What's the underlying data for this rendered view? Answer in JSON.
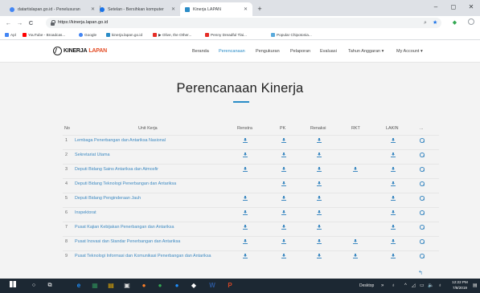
{
  "browser": {
    "tabs": [
      {
        "label": "datartislapan.go.id - Penelusuran",
        "close": "✕",
        "favicon_color": "#4285f4"
      },
      {
        "label": "Setelan - Bersihkan komputer",
        "close": "✕",
        "favicon_color": "#1a73e8"
      },
      {
        "label": "Kinerja LAPAN",
        "close": "✕",
        "favicon_color": "#2a8cc7"
      }
    ],
    "new_tab": "+",
    "window_controls": {
      "minimize": "–",
      "maximize": "◻",
      "close": "✕"
    },
    "nav": {
      "back": "←",
      "forward": "→",
      "reload": "C"
    },
    "url": "https://kinerja.lapan.go.id",
    "bookmarks": [
      {
        "label": "Apl",
        "color": "#4285f4"
      },
      {
        "label": "YouTube - Broadcas...",
        "color": "#ff0000"
      },
      {
        "label": "Google",
        "color": "#4285f4"
      },
      {
        "label": "kinerja.lapan.go.id",
        "color": "#2a8cc7"
      },
      {
        "label": "▶ Olive, the Other...",
        "color": "#e52d27"
      },
      {
        "label": "Penny Dreadful Tlai...",
        "color": "#e52d27"
      },
      {
        "label": "Popular Chipotonia...",
        "color": "#5aaadc"
      }
    ]
  },
  "site": {
    "logo_primary": "KINERJA",
    "logo_accent": "LAPAN",
    "nav": [
      {
        "label": "Beranda",
        "active": false
      },
      {
        "label": "Perencanaan",
        "active": true
      },
      {
        "label": "Pengukuran",
        "active": false
      },
      {
        "label": "Pelaporan",
        "active": false
      },
      {
        "label": "Evaluasi",
        "active": false
      },
      {
        "label": "Tahun Anggaran ▾",
        "active": false
      },
      {
        "label": "My Account ▾",
        "active": false
      }
    ],
    "accent_color": "#2a8cc7"
  },
  "main": {
    "title": "Perencanaan Kinerja",
    "table": {
      "headers": [
        "No",
        "Unit Kerja",
        "Renstra",
        "PK",
        "Renaksi",
        "RKT",
        "LAKIN",
        "..."
      ],
      "rows": [
        {
          "no": "1",
          "unit": "Lembaga Penerbangan dan Antariksa Nasional",
          "renstra": true,
          "pk": true,
          "renaksi": true,
          "rkt": false,
          "lakin": true
        },
        {
          "no": "2",
          "unit": "Sekretariat Utama",
          "renstra": true,
          "pk": true,
          "renaksi": true,
          "rkt": false,
          "lakin": true
        },
        {
          "no": "3",
          "unit": "Deputi Bidang Sains Antariksa dan Atmosfir",
          "renstra": true,
          "pk": true,
          "renaksi": true,
          "rkt": true,
          "lakin": true
        },
        {
          "no": "4",
          "unit": "Deputi Bidang Teknologi Penerbangan dan Antariksa",
          "renstra": false,
          "pk": true,
          "renaksi": true,
          "rkt": false,
          "lakin": true
        },
        {
          "no": "5",
          "unit": "Deputi Bidang Penginderaan Jauh",
          "renstra": true,
          "pk": true,
          "renaksi": true,
          "rkt": false,
          "lakin": true
        },
        {
          "no": "6",
          "unit": "Inspektorat",
          "renstra": true,
          "pk": true,
          "renaksi": true,
          "rkt": false,
          "lakin": true
        },
        {
          "no": "7",
          "unit": "Pusat Kajian Kebijakan Penerbangan dan Antariksa",
          "renstra": true,
          "pk": true,
          "renaksi": true,
          "rkt": false,
          "lakin": true
        },
        {
          "no": "8",
          "unit": "Pusat Inovasi dan Standar Penerbangan dan Antariksa",
          "renstra": true,
          "pk": true,
          "renaksi": true,
          "rkt": true,
          "lakin": true
        },
        {
          "no": "9",
          "unit": "Pusat Teknologi Informasi dan Komunikasi Penerbangan dan Antariksa",
          "renstra": true,
          "pk": true,
          "renaksi": true,
          "rkt": true,
          "lakin": true
        }
      ]
    },
    "undo_glyph": "↰"
  },
  "taskbar": {
    "desktop_label": "Desktop",
    "time": "12:22 PM",
    "date": "7/8/2019",
    "apps": [
      {
        "color": "#1e90ff",
        "glyph": "e"
      },
      {
        "color": "#2e8b57",
        "glyph": "▦"
      },
      {
        "color": "#f4b400",
        "glyph": "▤"
      },
      {
        "color": "#e0e0e0",
        "glyph": "▣"
      },
      {
        "color": "#ff7f27",
        "glyph": "●"
      },
      {
        "color": "#34a853",
        "glyph": "●"
      },
      {
        "color": "#1e90ff",
        "glyph": "●"
      },
      {
        "color": "#ffffff",
        "glyph": "◆"
      },
      {
        "color": "#2b579a",
        "glyph": "W"
      },
      {
        "color": "#d24726",
        "glyph": "P"
      }
    ]
  }
}
